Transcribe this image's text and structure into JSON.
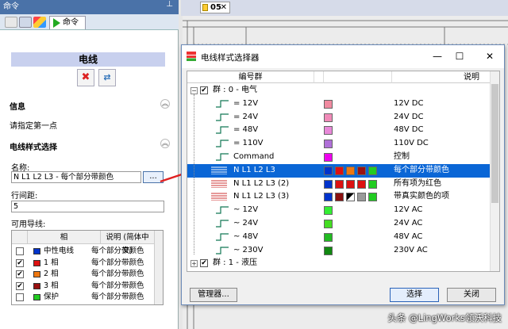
{
  "left_panel": {
    "title": "命令",
    "pin_icon": "⊥",
    "tab_label": "命令",
    "header": "电线",
    "info_label": "信息",
    "prompt": "请指定第一点",
    "style_section": "电线样式选择",
    "name_label": "名称:",
    "name_value": "N L1 L2 L3 - 每个部分带颜色",
    "name_button": "...",
    "spacing_label": "行间距:",
    "spacing_value": "5",
    "wires_label": "可用导线:",
    "col_phase": "相",
    "col_desc": "说明 (简体中文)",
    "wires": [
      {
        "checked": false,
        "color": "#0033cc",
        "name": "中性电线",
        "desc": "每个部分带颜色"
      },
      {
        "checked": true,
        "color": "#dd1111",
        "name": "1 相",
        "desc": "每个部分带颜色"
      },
      {
        "checked": true,
        "color": "#ee7711",
        "name": "2 相",
        "desc": "每个部分带颜色"
      },
      {
        "checked": true,
        "color": "#991111",
        "name": "3 相",
        "desc": "每个部分带颜色"
      },
      {
        "checked": false,
        "color": "#22cc22",
        "name": "保护",
        "desc": "每个部分带颜色"
      }
    ]
  },
  "document": {
    "tab": "05",
    "close": "✕"
  },
  "dialog": {
    "title": "电线样式选择器",
    "minimize": "—",
    "maximize": "☐",
    "close": "✕",
    "col_group": "编号群",
    "col_desc": "说明",
    "rows": [
      {
        "kind": "group",
        "toggle": "−",
        "checked": true,
        "label": "群 : 0 - 电气",
        "desc": ""
      },
      {
        "kind": "wire",
        "label": "=  12V",
        "cells": [
          "#f08aa0"
        ],
        "desc": "12V DC"
      },
      {
        "kind": "wire",
        "label": "=  24V",
        "cells": [
          "#f08ab8"
        ],
        "desc": "24V DC"
      },
      {
        "kind": "wire",
        "label": "=  48V",
        "cells": [
          "#e888d8"
        ],
        "desc": "48V DC"
      },
      {
        "kind": "wire",
        "label": "=  110V",
        "cells": [
          "#b070d8"
        ],
        "desc": "110V DC"
      },
      {
        "kind": "wire",
        "label": "Command",
        "cells": [
          "#ee00ee"
        ],
        "desc": "控制"
      },
      {
        "kind": "multi",
        "selected": true,
        "label": "N L1 L2 L3",
        "cells": [
          "#0033cc",
          "#dd1111",
          "#ee7711",
          "#991111",
          "#22cc22"
        ],
        "desc": "每个部分带颜色"
      },
      {
        "kind": "multi",
        "label": "N L1 L2 L3 (2)",
        "cells": [
          "#0033cc",
          "#dd1111",
          "#dd1111",
          "#dd1111",
          "#22cc22"
        ],
        "desc": "所有项为红色"
      },
      {
        "kind": "multi",
        "label": "N L1 L2 L3 (3)",
        "cells": [
          "#0033cc",
          "#8a1010",
          "diag",
          "#999999",
          "#22cc22"
        ],
        "desc": "带真实颜色的项"
      },
      {
        "kind": "wire",
        "label": "~  12V",
        "cells": [
          "#33ee33"
        ],
        "desc": "12V AC"
      },
      {
        "kind": "wire",
        "label": "~  24V",
        "cells": [
          "#44dd22"
        ],
        "desc": "24V AC"
      },
      {
        "kind": "wire",
        "label": "~  48V",
        "cells": [
          "#22bb22"
        ],
        "desc": "48V AC"
      },
      {
        "kind": "wire",
        "label": "~  230V",
        "cells": [
          "#118811"
        ],
        "desc": "230V AC"
      },
      {
        "kind": "group",
        "toggle": "+",
        "checked": true,
        "label": "群 : 1 - 液压",
        "desc": ""
      }
    ],
    "manager_button": "管理器...",
    "select_button": "选择",
    "close_button": "关闭"
  },
  "watermark": "头条 @LingWorks领沃科技"
}
